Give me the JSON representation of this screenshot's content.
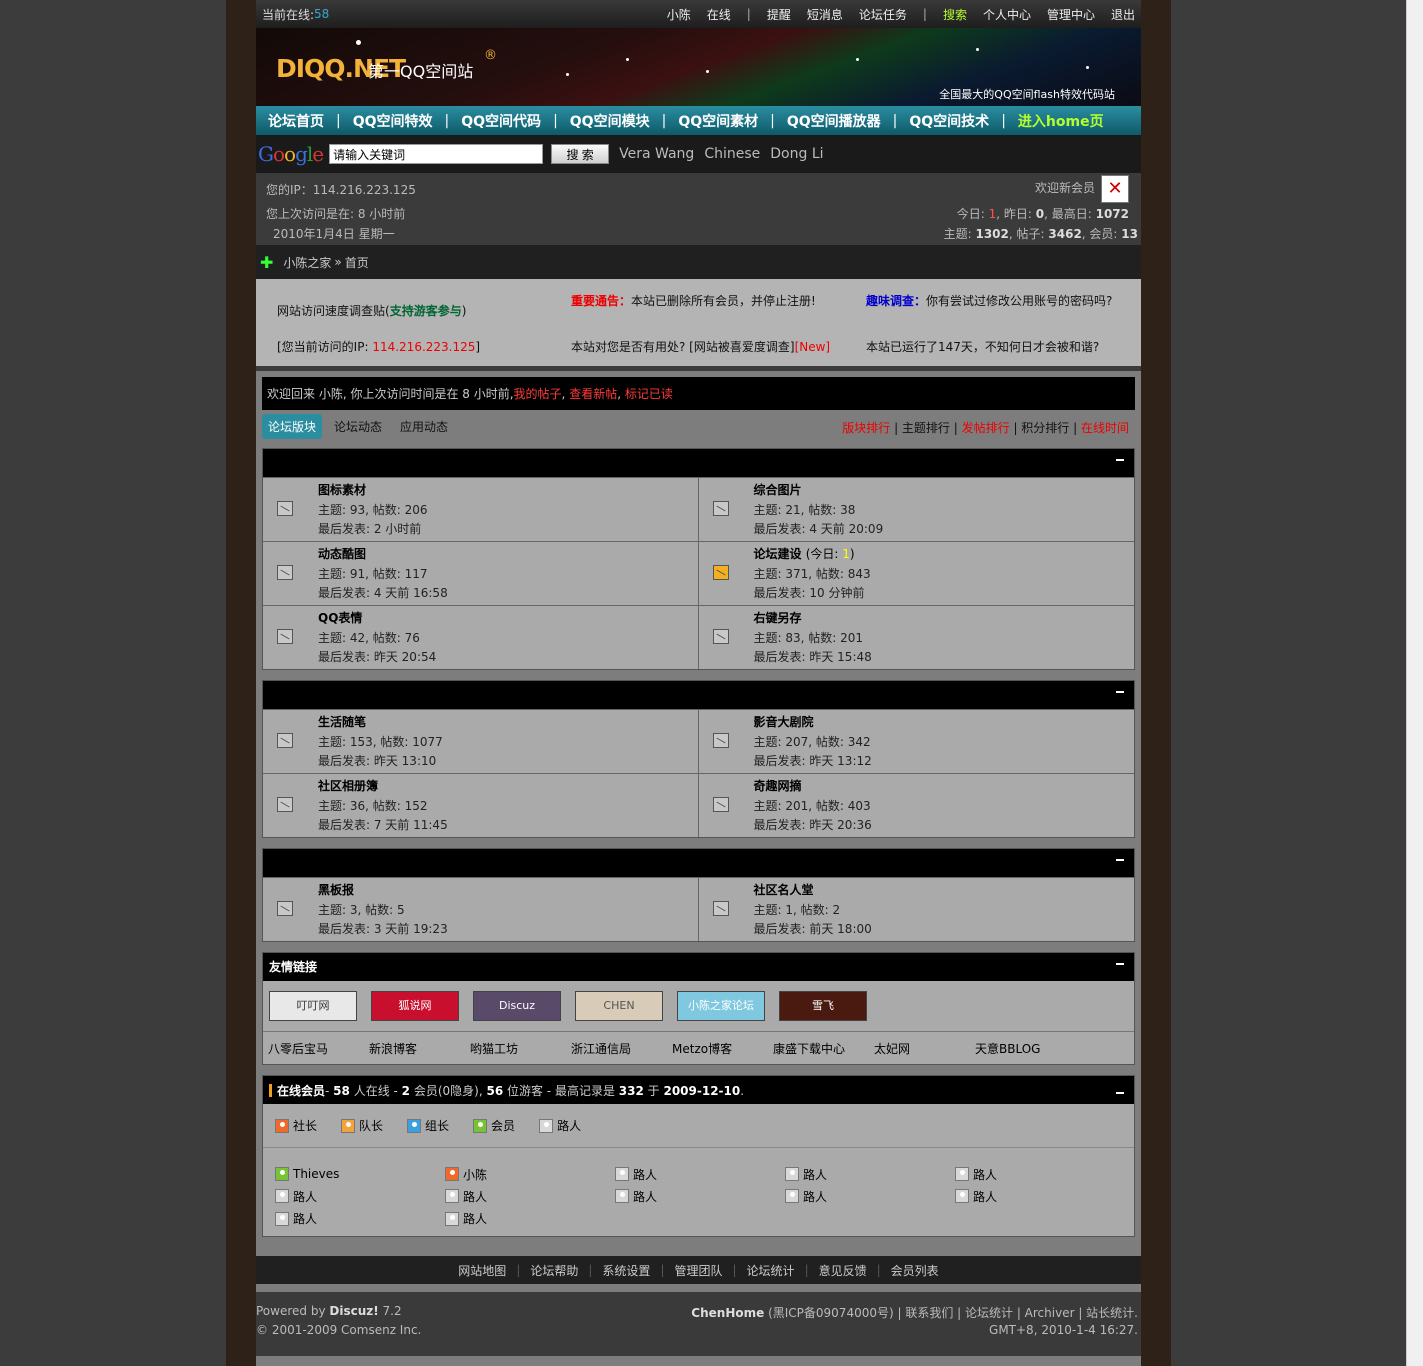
{
  "topbar": {
    "online_label": "当前在线:",
    "online_count": "58",
    "user": "小陈",
    "status": "在线",
    "links": [
      "提醒",
      "短消息",
      "论坛任务"
    ],
    "search": "搜索",
    "links2": [
      "个人中心",
      "管理中心",
      "退出"
    ]
  },
  "banner": {
    "logo": "DIQQ.NET",
    "logo_cn": "第一QQ空间站",
    "slogan": "全国最大的QQ空间flash特效代码站"
  },
  "nav": {
    "items": [
      "论坛首页",
      "QQ空间特效",
      "QQ空间代码",
      "QQ空间模块",
      "QQ空间素材",
      "QQ空间播放器",
      "QQ空间技术"
    ],
    "home": "进入home页"
  },
  "search": {
    "google": "Google",
    "value": "请输入关键词",
    "button": "搜 索",
    "tags": [
      "Vera Wang",
      "Chinese",
      "Dong Li"
    ]
  },
  "info": {
    "ip": "您的IP：114.216.223.125",
    "last": "您上次访问是在: 8 小时前",
    "date": "2010年1月4日  星期一",
    "welcome": "欢迎新会员",
    "today_l": "今日: ",
    "today": "1",
    "yest_l": ", 昨日: ",
    "yest": "0",
    "max_l": ", 最高日: ",
    "max": "1072",
    "topics_l": "主题: ",
    "topics": "1302",
    "posts_l": ", 帖子: ",
    "posts": "3462",
    "members_l": ", 会员: ",
    "members": "13"
  },
  "crumb": {
    "home": "小陈之家",
    "sep": "»",
    "page": "首页"
  },
  "ann": {
    "a1a": "网站访问速度调查贴(",
    "a1b": "支持游客参与",
    "a1c": ")",
    "a2a": "[您当前访问的IP: ",
    "a2b": "114.216.223.125",
    "a2c": "]",
    "b1a": "重要通告：",
    "b1b": "本站已删除所有会员，并停止注册!",
    "b2a": "本站对您是否有用处? [网站被喜爱度调查]",
    "b2b": "[New]",
    "c1a": "趣味调查：",
    "c1b": "你有尝试过修改公用账号的密码吗?",
    "c2": "本站已运行了147天，不知何日才会被和谐?"
  },
  "welcome": {
    "pre": "欢迎回来  小陈, 你上次访问时间是在  8 小时前, ",
    "l1": "我的帖子",
    "l2": "查看新帖",
    "l3": "标记已读"
  },
  "tabs": [
    "论坛版块",
    "论坛动态",
    "应用动态"
  ],
  "ranks": [
    "版块排行",
    "主题排行",
    "发帖排行",
    "积分排行",
    "在线时间"
  ],
  "cats": [
    {
      "title": "",
      "forums": [
        {
          "name": "图标素材",
          "stats": "主题: 93, 帖数: 206",
          "last": "最后发表: 2 小时前"
        },
        {
          "name": "综合图片",
          "stats": "主题: 21, 帖数: 38",
          "last": "最后发表: 4 天前 20:09"
        },
        {
          "name": "动态酷图",
          "stats": "主题: 91, 帖数: 117",
          "last": "最后发表: 4 天前 16:58"
        },
        {
          "name": "论坛建设",
          "today_pre": "(今日: ",
          "today": "1",
          "today_post": ")",
          "stats": "主题: 371, 帖数: 843",
          "last": "最后发表: 10 分钟前",
          "new": true
        },
        {
          "name": "QQ表情",
          "stats": "主题: 42, 帖数: 76",
          "last": "最后发表: 昨天 20:54"
        },
        {
          "name": "右键另存",
          "stats": "主题: 83, 帖数: 201",
          "last": "最后发表: 昨天 15:48"
        }
      ]
    },
    {
      "title": "",
      "forums": [
        {
          "name": "生活随笔",
          "stats": "主题: 153, 帖数: 1077",
          "last": "最后发表: 昨天 13:10"
        },
        {
          "name": "影音大剧院",
          "stats": "主题: 207, 帖数: 342",
          "last": "最后发表: 昨天 13:12"
        },
        {
          "name": "社区相册簿",
          "stats": "主题: 36, 帖数: 152",
          "last": "最后发表: 7 天前 11:45"
        },
        {
          "name": "奇趣网摘",
          "stats": "主题: 201, 帖数: 403",
          "last": "最后发表: 昨天 20:36"
        }
      ]
    },
    {
      "title": "",
      "forums": [
        {
          "name": "黑板报",
          "stats": "主题: 3, 帖数: 5",
          "last": "最后发表: 3 天前 19:23"
        },
        {
          "name": "社区名人堂",
          "stats": "主题: 1, 帖数: 2",
          "last": "最后发表: 前天 18:00"
        }
      ]
    }
  ],
  "links": {
    "title": "友情链接",
    "logos": [
      {
        "text": "叮叮网",
        "color": "#e8e8e8"
      },
      {
        "text": "狐说网",
        "color": "#c8102e"
      },
      {
        "text": "Discuz",
        "color": "#5a4a6a"
      },
      {
        "text": "CHEN",
        "color": "#d8ccb8"
      },
      {
        "text": "小陈之家论坛",
        "color": "#7fc8e0"
      },
      {
        "text": "雪飞",
        "color": "#4a1a10"
      }
    ],
    "texts": [
      "八零后宝马",
      "新浪博客",
      "哟猫工坊",
      "浙江通信局",
      "Metzo博客",
      "康盛下载中心",
      "太妃网",
      "天意BBLOG"
    ]
  },
  "members": {
    "title": "在线会员",
    "summary_pre": " - ",
    "total": "58",
    "total_l": " 人在线  - ",
    "members": "2",
    "members_l": " 会员(0隐身), ",
    "guests": "56",
    "guests_l": " 位游客  - 最高记录是  ",
    "record": "332",
    "record_l": " 于  ",
    "record_date": "2009-12-10",
    "record_end": ".",
    "legend": [
      "社长",
      "队长",
      "组长",
      "会员",
      "路人"
    ],
    "users": [
      {
        "n": "Thieves",
        "c": "c4"
      },
      {
        "n": "小陈",
        "c": "c1"
      },
      {
        "n": "路人",
        "c": "c5"
      },
      {
        "n": "路人",
        "c": "c5"
      },
      {
        "n": "路人",
        "c": "c5"
      },
      {
        "n": "路人",
        "c": "c5"
      },
      {
        "n": "路人",
        "c": "c5"
      },
      {
        "n": "路人",
        "c": "c5"
      },
      {
        "n": "路人",
        "c": "c5"
      },
      {
        "n": "路人",
        "c": "c5"
      },
      {
        "n": "路人",
        "c": "c5"
      },
      {
        "n": "路人",
        "c": "c5"
      }
    ]
  },
  "footnav": [
    "网站地图",
    "论坛帮助",
    "系统设置",
    "管理团队",
    "论坛统计",
    "意见反馈",
    "会员列表"
  ],
  "foot": {
    "powered": "Powered by ",
    "discuz": "Discuz!",
    "ver": " 7.2",
    "copy": "© 2001-2009 Comsenz Inc.",
    "site": "ChenHome",
    "icp": " (黑ICP备09074000号) | 联系我们  | 论坛统计 | Archiver | 站长统计.",
    "time": "GMT+8, 2010-1-4 16:27."
  }
}
